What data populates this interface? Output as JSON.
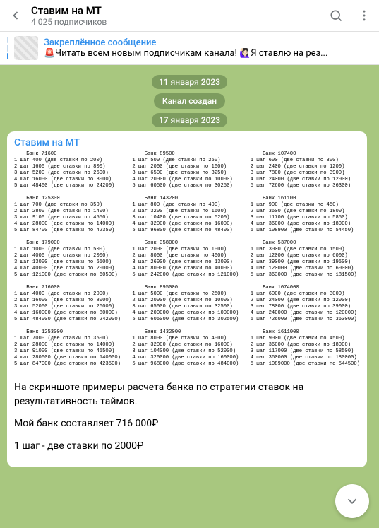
{
  "header": {
    "channel_name": "Ставим на МТ",
    "subscribers": "4 025 подписчиков"
  },
  "pinned": {
    "title": "Закреплённое сообщение",
    "preview": "🚨Читать всем новым подписчикам канала!  🙋🏻‍♀️Я ставлю на рез..."
  },
  "dates": {
    "d1": "11 января 2023",
    "service": "Канал создан",
    "d2": "17 января 2023"
  },
  "message": {
    "from": "Ставим на МТ",
    "p1": "На скриншоте примеры расчета банка по стратегии ставок на результативность таймов.",
    "p2": "Мой банк составляет 716 000₽",
    "p3": "1 шаг - две ставки по 2000₽"
  },
  "banks": [
    {
      "title": "Банк 71600",
      "rows": [
        "1 шаг 400 (две ставки по 200)",
        "2 шаг 1600 (две ставки по 800)",
        "3 шаг 5200 (две ставки по 2600)",
        "4 шаг 16000 (две ставки по 8000)",
        "5 шаг 48400 (две ставки по 24200)"
      ]
    },
    {
      "title": "Банк 89500",
      "rows": [
        "1 шаг 500 (две ставки по 250)",
        "2 шаг 2000 (две ставки по 1000)",
        "3 шаг 6500 (две ставки по 3250)",
        "4 шаг 20000 (две ставки по 10000)",
        "5 шаг 60500 (две ставки по 30250)"
      ]
    },
    {
      "title": "Банк 107400",
      "rows": [
        "1 шаг 600 (две ставки по 300)",
        "2 шаг 2400 (две ставки по 1200)",
        "3 шаг 7800 (две ставки по 3900)",
        "4 шаг 24000 (две ставки по 12000)",
        "5 шаг 72600 (две ставки по 36300)"
      ]
    },
    {
      "title": "Банк 125300",
      "rows": [
        "1 шаг 700 (две ставки по 350)",
        "2 шаг 2800 (две ставки по 1400)",
        "3 шаг 9100 (две ставки по 4550)",
        "4 шаг 28000 (две ставки по 14000)",
        "5 шаг 84700 (две ставки по 42350)"
      ]
    },
    {
      "title": "Банк 143200",
      "rows": [
        "1 шаг 800 (две ставки по 400)",
        "2 шаг 3200 (две ставки по 1600)",
        "3 шаг 10400 (две ставки по 5200)",
        "4 шаг 32000 (две ставки по 16000)",
        "5 шаг 96800 (две ставки по 48400)"
      ]
    },
    {
      "title": "Банк 161100",
      "rows": [
        "1 шаг 900 (две ставки по 450)",
        "2 шаг 3600 (две ставки по 1800)",
        "3 шаг 11700 (две ставки по 5850)",
        "4 шаг 36000 (две ставки по 18000)",
        "5 шаг 108900 (две ставки по 54450)"
      ]
    },
    {
      "title": "Банк 179000",
      "rows": [
        "1 шаг 1000 (две ставки по 500)",
        "2 шаг 4000 (две ставки по 2000)",
        "3 шаг 13000 (две ставки по 6500)",
        "4 шаг 40000 (две ставки по 20000)",
        "5 шаг 121000 (две ставки по 60500)"
      ]
    },
    {
      "title": "Банк 358000",
      "rows": [
        "1 шаг 2000 (две ставки по 1000)",
        "2 шаг 8000 (две ставки по 4000)",
        "3 шаг 26000 (две ставки по 13000)",
        "4 шаг 80000 (две ставки по 40000)",
        "5 шаг 242000 (две ставки по 121000)"
      ]
    },
    {
      "title": "Банк 537000",
      "rows": [
        "1 шаг 3000 (две ставки по 1500)",
        "2 шаг 12000 (две ставки по 6000)",
        "3 шаг 39000 (две ставки по 19500)",
        "4 шаг 120000 (две ставки по 60000)",
        "5 шаг 363000 (две ставки по 181500)"
      ]
    },
    {
      "title": "Банк 716000",
      "rows": [
        "1 шаг 4000 (две ставки по 2000)",
        "2 шаг 16000 (две ставки по 8000)",
        "3 шаг 52000 (две ставки по 26000)",
        "4 шаг 160000 (две ставки по 80000)",
        "5 шаг 484000 (две ставки по 242000)"
      ]
    },
    {
      "title": "Банк 895000",
      "rows": [
        "1 шаг 5000 (две ставки по 2500)",
        "2 шаг 20000 (две ставки по 10000)",
        "3 шаг 65000 (две ставки по 32500)",
        "4 шаг 200000 (две ставки по 100000)",
        "5 шаг 605000 (две ставки по 302500)"
      ]
    },
    {
      "title": "Банк 1074000",
      "rows": [
        "1 шаг 6000 (две ставки по 3000)",
        "2 шаг 24000 (две ставки по 12000)",
        "3 шаг 78000 (две ставки по 39000)",
        "4 шаг 240000 (две ставки по 120000)",
        "5 шаг 726000 (две ставки по 363000)"
      ]
    },
    {
      "title": "Банк 1253000",
      "rows": [
        "1 шаг 7000 (две ставки по 3500)",
        "2 шаг 28000 (две ставки по 14000)",
        "3 шаг 91000 (две ставки по 45500)",
        "4 шаг 280000 (две ставки по 140000)",
        "5 шаг 847000 (две ставки по 423500)"
      ]
    },
    {
      "title": "Банк 1432000",
      "rows": [
        "1 шаг 8000 (две ставки по 4000)",
        "2 шаг 32000 (две ставки по 16000)",
        "3 шаг 104000 (две ставки по 52000)",
        "4 шаг 320000 (две ставки по 160000)",
        "5 шаг 968000 (две ставки по 484000)"
      ]
    },
    {
      "title": "Банк 1611000",
      "rows": [
        "1 шаг 9000 (две ставки по 4500)",
        "2 шаг 36000 (две ставки по 18000)",
        "3 шаг 117000 (две ставки по 58500)",
        "4 шаг 360000 (две ставки по 180000)",
        "5 шаг 1089000 (две ставки по 544500)"
      ]
    }
  ]
}
